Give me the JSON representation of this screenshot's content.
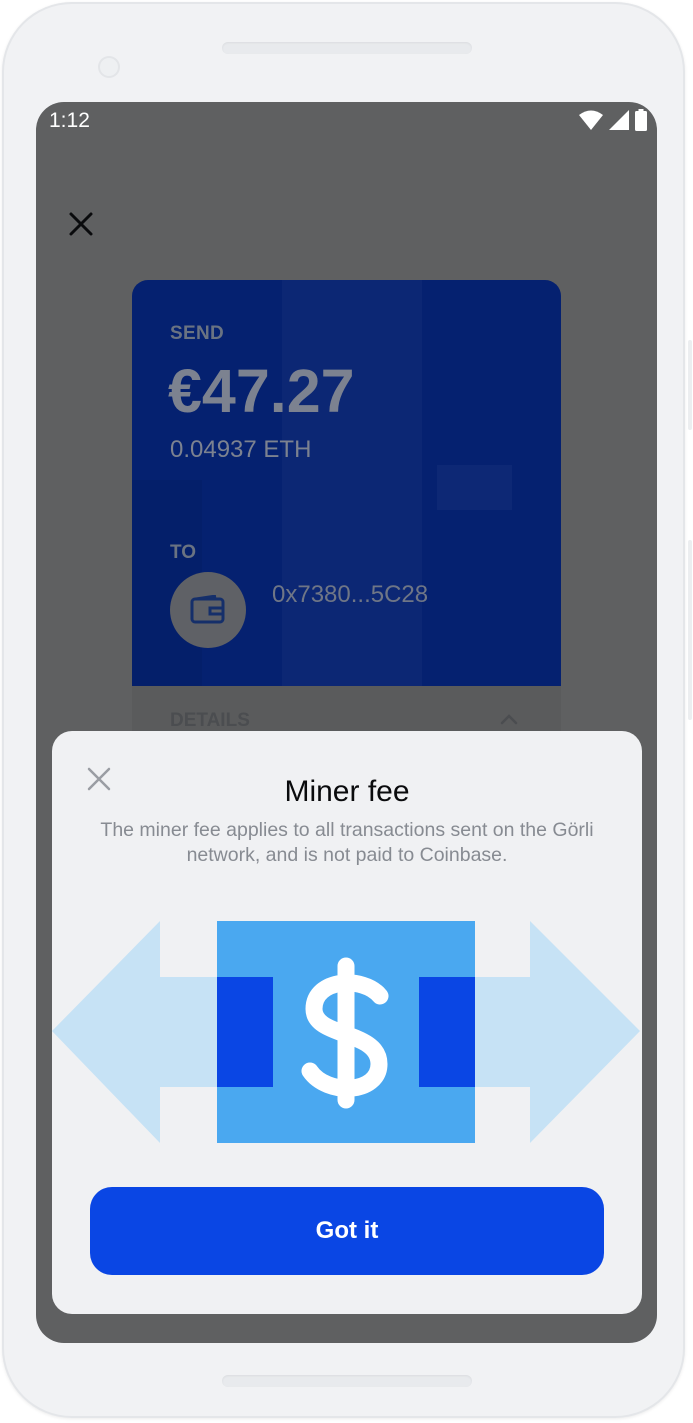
{
  "status_bar": {
    "time": "1:12",
    "icons": [
      "wifi-icon",
      "cell-signal-icon",
      "battery-icon"
    ]
  },
  "header": {
    "close_icon": "close-icon"
  },
  "send_card": {
    "send_label": "SEND",
    "amount_fiat": "€47.27",
    "amount_crypto": "0.04937 ETH",
    "to_label": "TO",
    "wallet_icon": "wallet-icon",
    "to_address": "0x7380...5C28",
    "details_label": "DETAILS",
    "details_icon": "chevron-up-icon"
  },
  "miner_fee_sheet": {
    "close_icon": "close-icon",
    "title": "Miner fee",
    "description": "The miner fee applies to all transactions sent on the Görli network, and is not paid to Coinbase.",
    "illustration_icon": "dollar-transfer-icon",
    "button_label": "Got it"
  },
  "colors": {
    "primary_button": "#0a46e4",
    "card_background": "#052170",
    "overlay": "#5f6061",
    "sheet_background": "#f0f1f3",
    "illustration_light_blue": "#c6e2f5",
    "illustration_mid_blue": "#4aa8f0",
    "illustration_dark_blue": "#0a46e4"
  }
}
